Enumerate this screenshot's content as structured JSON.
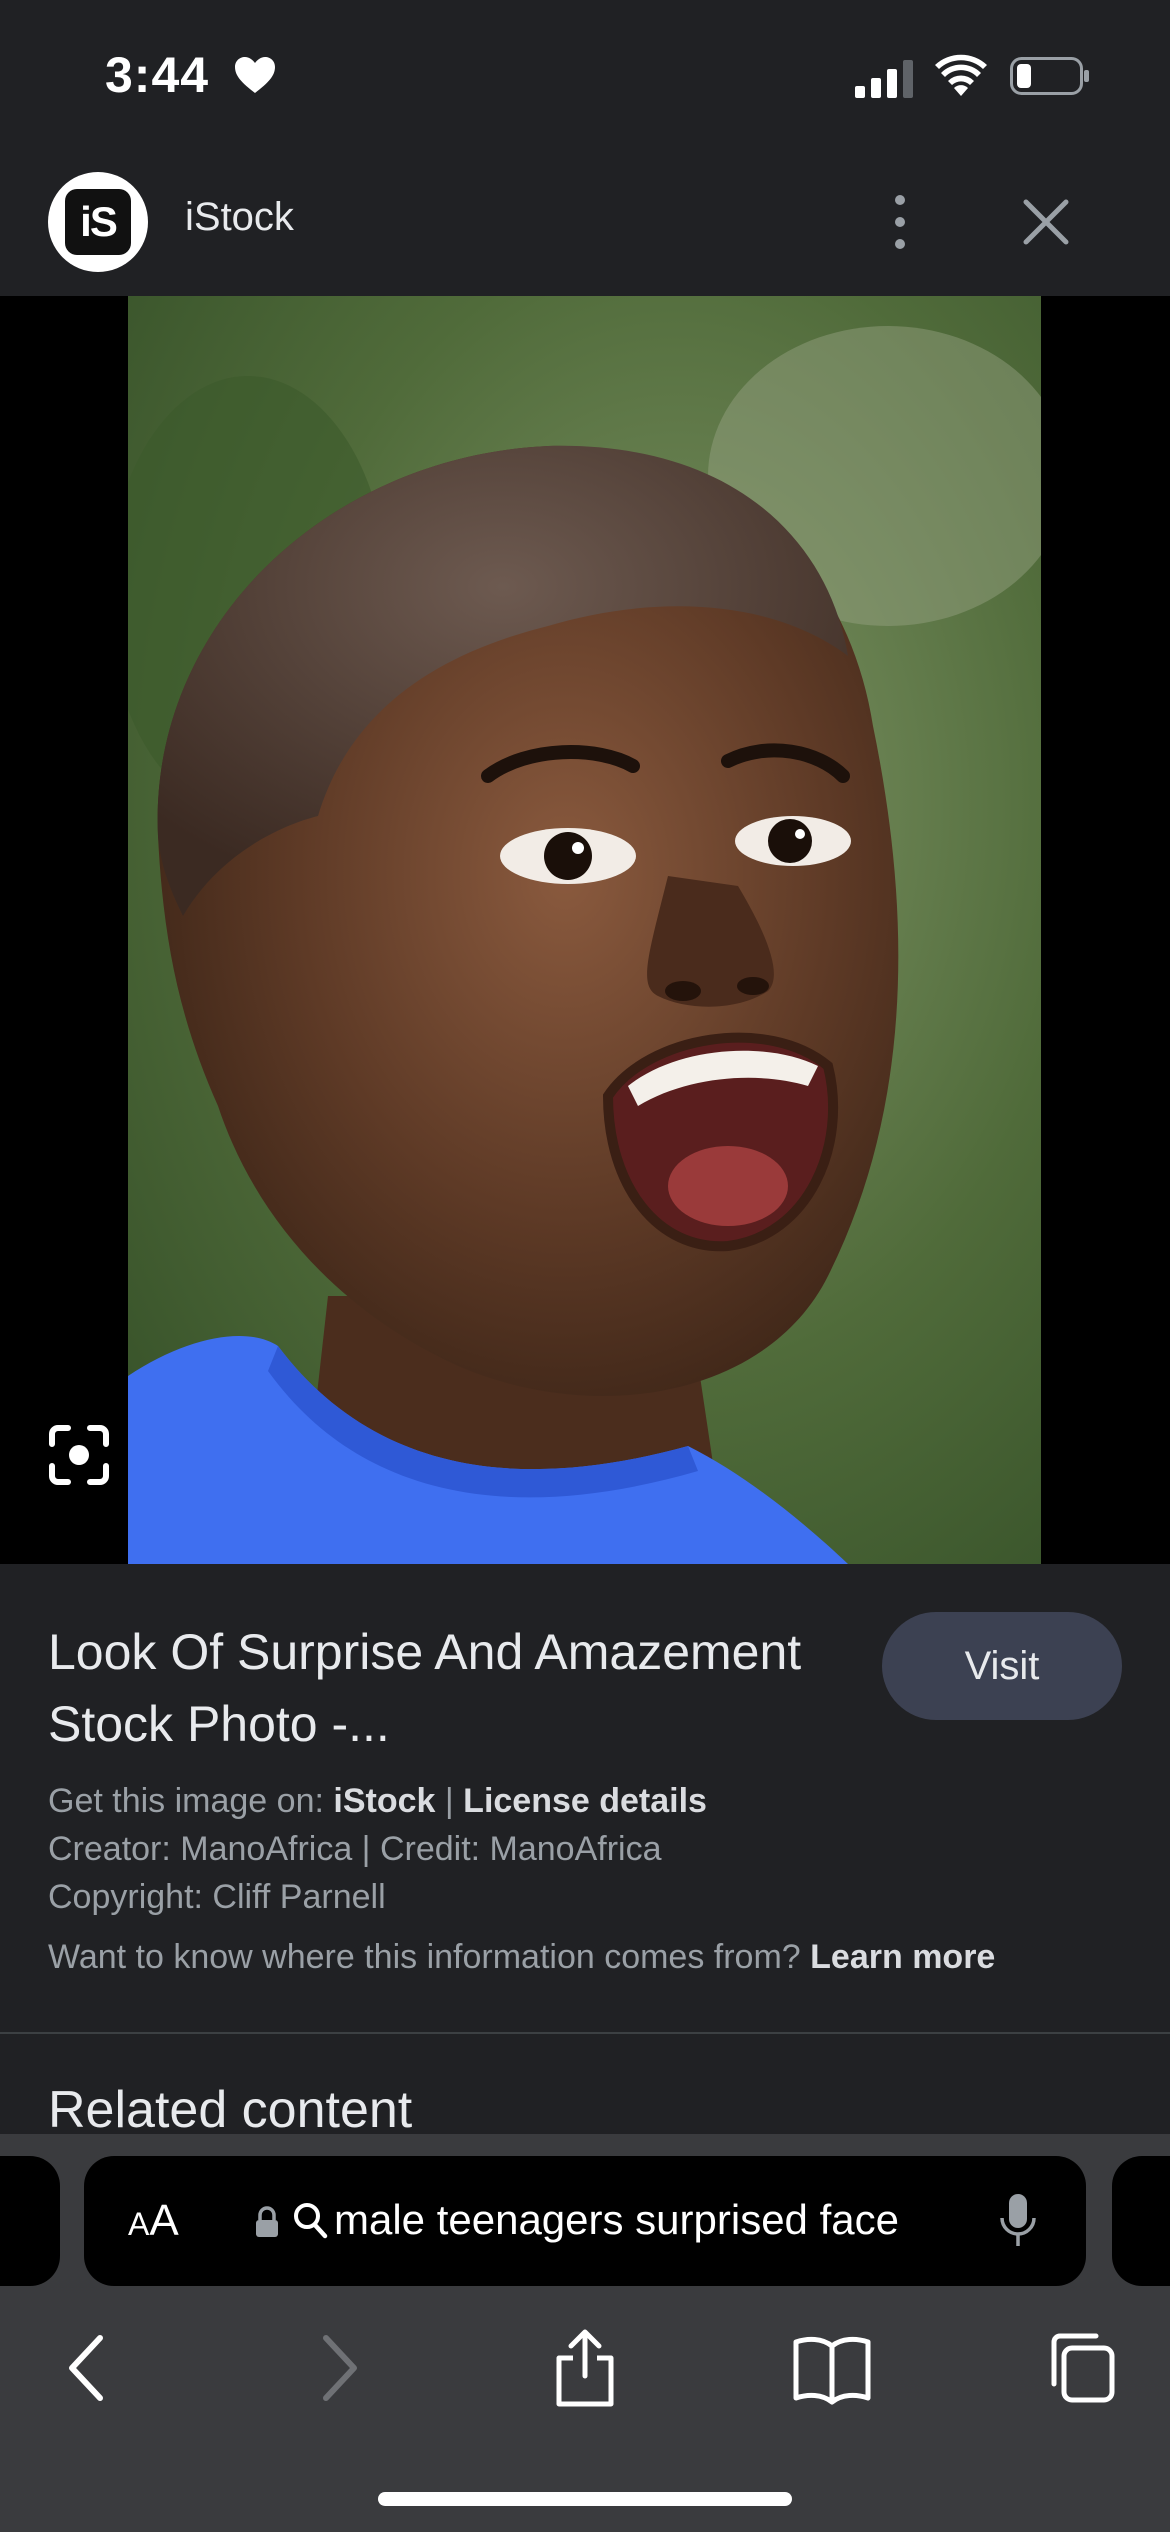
{
  "status_bar": {
    "time": "3:44",
    "icons": [
      "heart-icon",
      "cellular-signal-icon",
      "wifi-icon",
      "battery-icon"
    ]
  },
  "source": {
    "logo_text": "iS",
    "name": "iStock",
    "icons": [
      "more-vertical-icon",
      "close-icon"
    ]
  },
  "image": {
    "lens_icon": "google-lens-icon"
  },
  "info": {
    "title": "Look Of Surprise And Amazement Stock Photo -...",
    "visit_label": "Visit",
    "get_image_prefix": "Get this image on:",
    "get_image_source": "iStock",
    "separator": "|",
    "license_details": "License details",
    "creator_line": "Creator: ManoAfrica | Credit: ManoAfrica",
    "copyright_line": "Copyright: Cliff Parnell",
    "info_question": "Want to know where this information comes from?",
    "learn_more": "Learn more"
  },
  "related": {
    "title": "Related content"
  },
  "browser": {
    "aa_label_small": "A",
    "aa_label_large": "A",
    "address_text": "male teenagers surprised face",
    "nav_icons": [
      "back-icon",
      "forward-icon",
      "share-icon",
      "bookmarks-icon",
      "tabs-icon"
    ]
  },
  "colors": {
    "background": "#202124",
    "visit_button": "#3c4152",
    "toolbar": "#3a3b3e"
  }
}
